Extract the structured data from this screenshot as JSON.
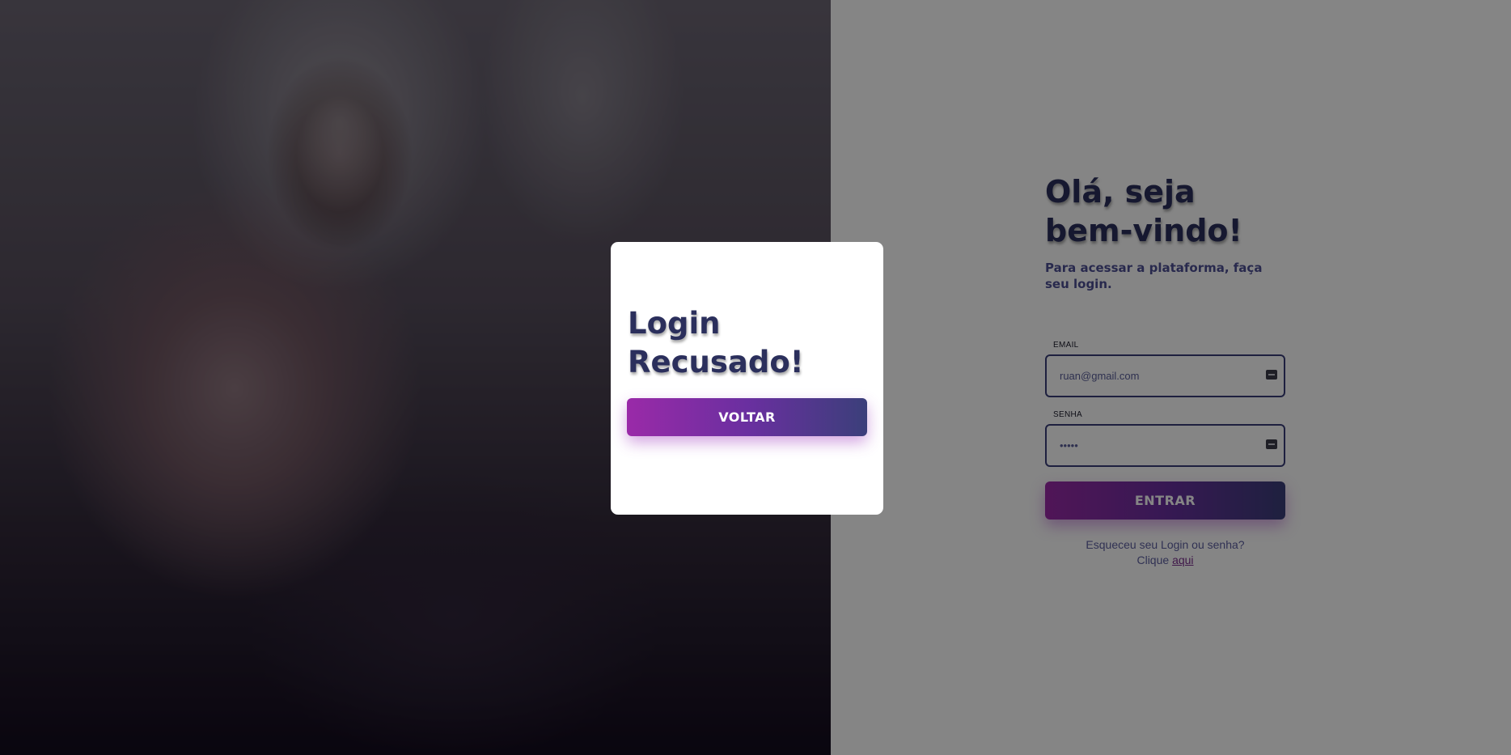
{
  "welcome": {
    "title": "Olá, seja bem-vindo!",
    "subtitle": "Para acessar a plataforma, faça seu login."
  },
  "form": {
    "email_label": "EMAIL",
    "email_value": "ruan@gmail.com",
    "senha_label": "SENHA",
    "senha_value": "•••••",
    "submit_label": "ENTRAR",
    "forgot_text": "Esqueceu seu Login ou senha?",
    "forgot_prefix": "Clique",
    "forgot_link": "aqui"
  },
  "modal": {
    "title": "Login Recusado!",
    "button_label": "VOLTAR"
  },
  "colors": {
    "primary_dark": "#2b2f5c",
    "accent_purple": "#9a2aa8",
    "accent_indigo": "#3b3f7a",
    "overlay": "rgba(0,0,0,0.48)"
  },
  "icons": {
    "field_icon": "password-manager-icon"
  }
}
